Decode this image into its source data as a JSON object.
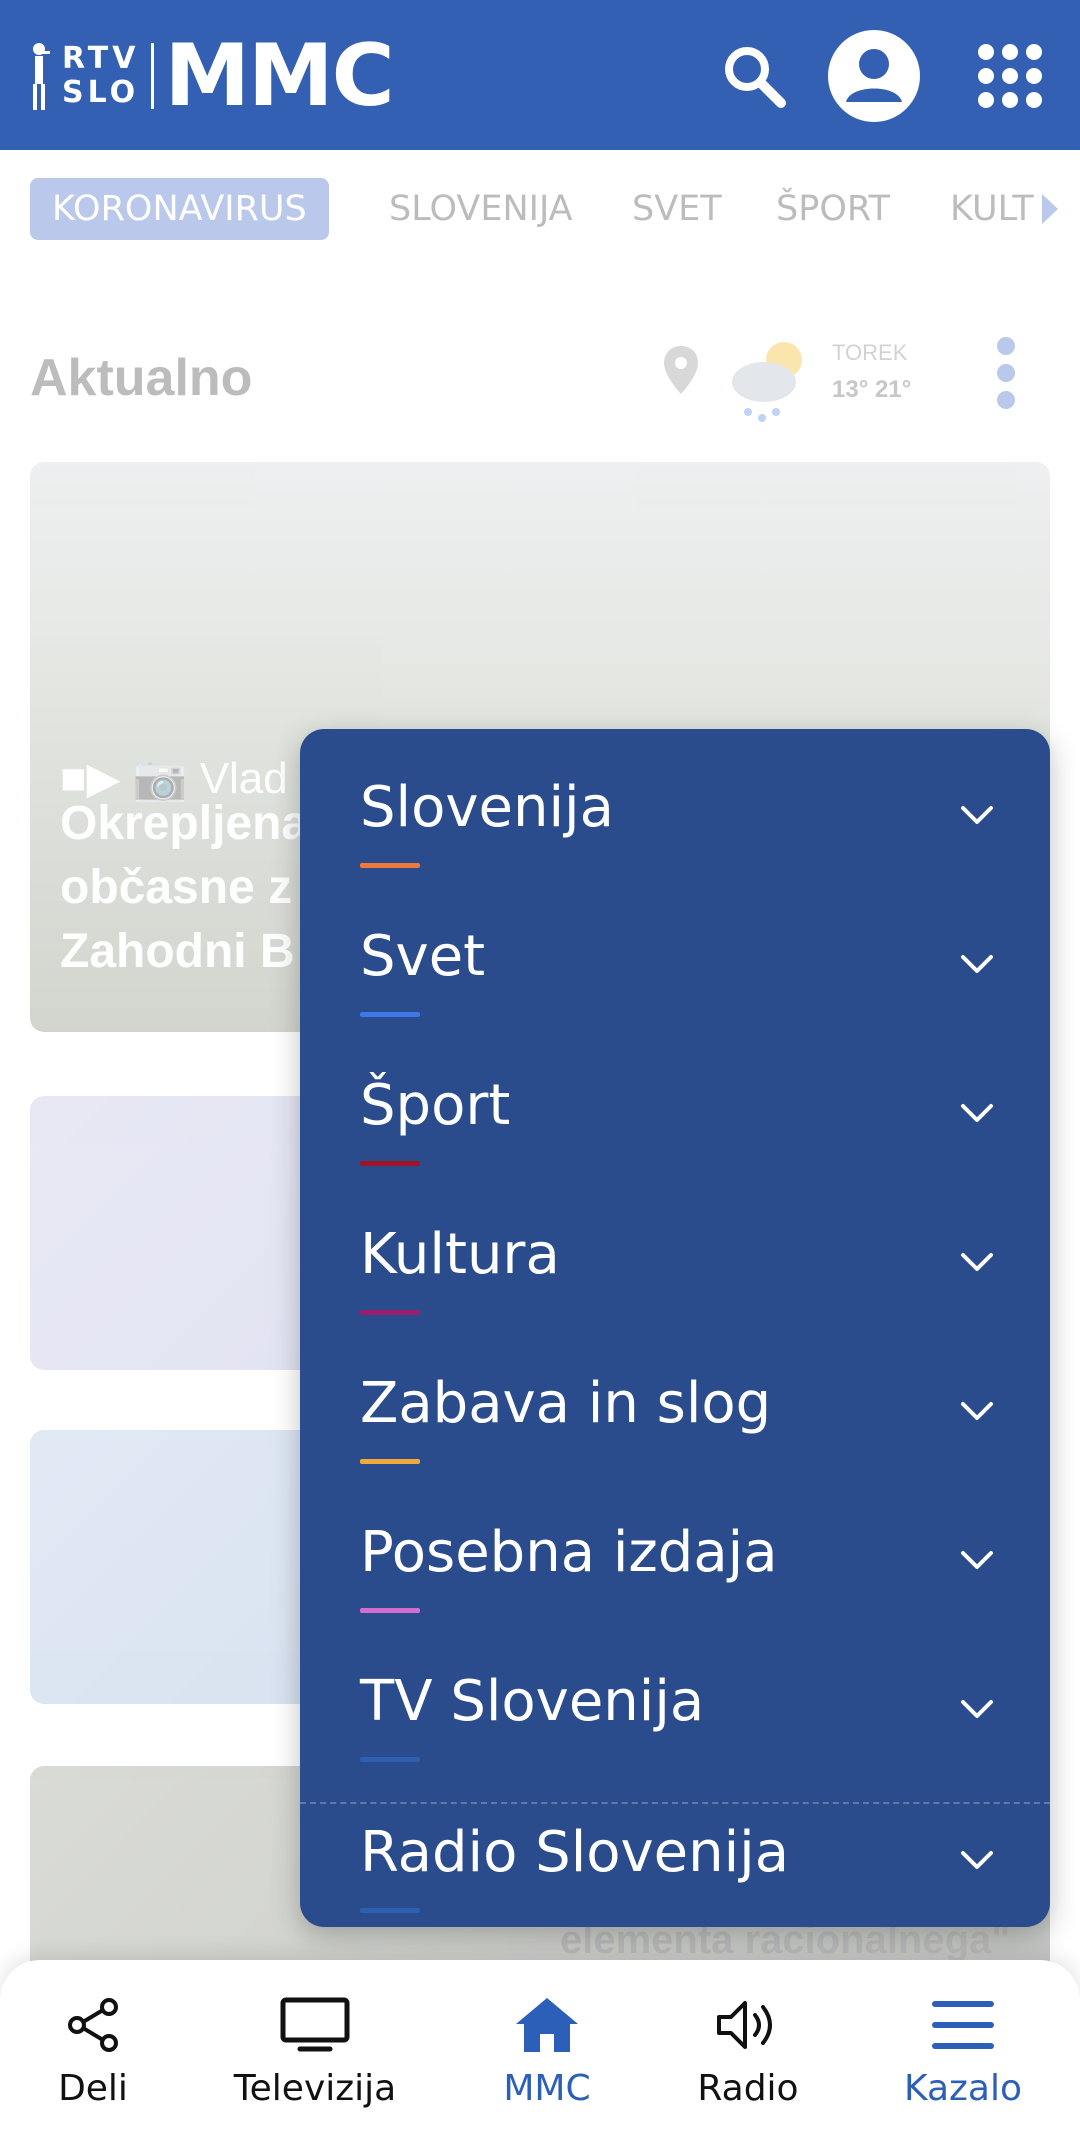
{
  "header": {
    "logo_rtv_line1": "RTV",
    "logo_rtv_line2": "SLO",
    "logo_mmc": "MMC"
  },
  "categories": {
    "items": [
      "KORONAVIRUS",
      "SLOVENIJA",
      "SVET",
      "ŠPORT",
      "KULT"
    ],
    "active": "KORONAVIRUS"
  },
  "content": {
    "section_title": "Aktualno",
    "weather": {
      "day": "TOREK",
      "temps": "13° 21°"
    },
    "card1": {
      "lines": [
        "Vlad",
        "Okrepljena",
        "občasne z",
        "Zahodni B"
      ]
    },
    "teaser": "elementa racionalnega\""
  },
  "menu": {
    "items": [
      {
        "label": "Slovenija",
        "color": "#f0783c"
      },
      {
        "label": "Svet",
        "color": "#3c78e6"
      },
      {
        "label": "Šport",
        "color": "#a01428"
      },
      {
        "label": "Kultura",
        "color": "#9b1e6e"
      },
      {
        "label": "Zabava in slog",
        "color": "#f0aa3c"
      },
      {
        "label": "Posebna izdaja",
        "color": "#d26ed2"
      },
      {
        "label": "TV Slovenija",
        "color": "#2e5fb0"
      },
      {
        "label": "Radio Slovenija",
        "color": "#2e5fb0"
      }
    ]
  },
  "bottom_nav": {
    "items": [
      "Deli",
      "Televizija",
      "MMC",
      "Radio",
      "Kazalo"
    ]
  },
  "colors": {
    "header_bg": "#3460b3",
    "menu_bg": "#2b4c8c",
    "accent": "#2c5fb8"
  }
}
